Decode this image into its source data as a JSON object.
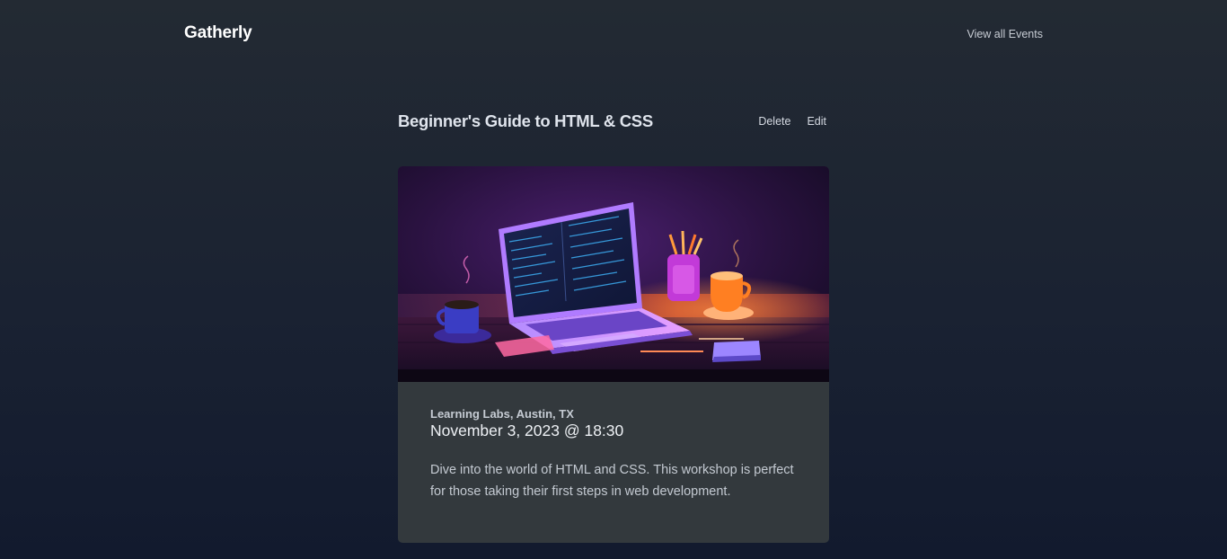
{
  "header": {
    "brand": "Gatherly",
    "nav_link": "View all Events"
  },
  "event": {
    "title": "Beginner's Guide to HTML & CSS",
    "actions": {
      "delete_label": "Delete",
      "edit_label": "Edit"
    },
    "location": "Learning Labs, Austin, TX",
    "datetime": "November 3, 2023 @ 18:30",
    "description": "Dive into the world of HTML and CSS. This workshop is perfect for those taking their first steps in web development."
  },
  "colors": {
    "background_top": "#232a33",
    "background_bottom": "#121a2e",
    "card": "#33393d",
    "accent_purple": "#a74dff",
    "accent_orange": "#ff7a2e"
  }
}
